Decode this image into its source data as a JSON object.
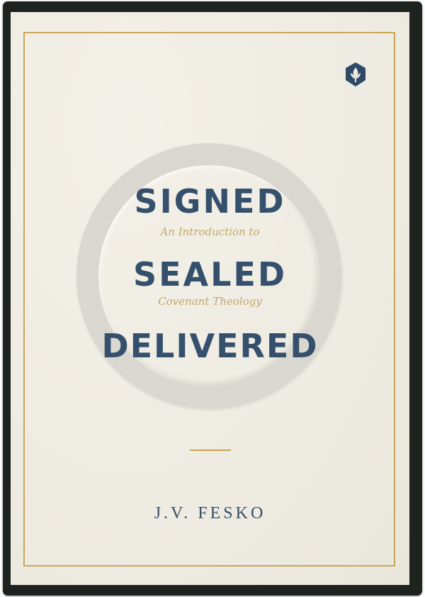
{
  "cover": {
    "title_lines": [
      "SIGNED",
      "SEALED",
      "DELIVERED"
    ],
    "subtitle_lines": [
      "An Introduction to",
      "Covenant Theology"
    ],
    "author": "J.V. FESKO",
    "publisher_logo": "ligonier-tree-icon"
  },
  "colors": {
    "case": "#1f2320",
    "paper": "#eeebe2",
    "gold": "#c9a655",
    "title_blue": "#35506c",
    "subtitle_gold": "#c5a66a",
    "ring": "#d9d7d0"
  }
}
